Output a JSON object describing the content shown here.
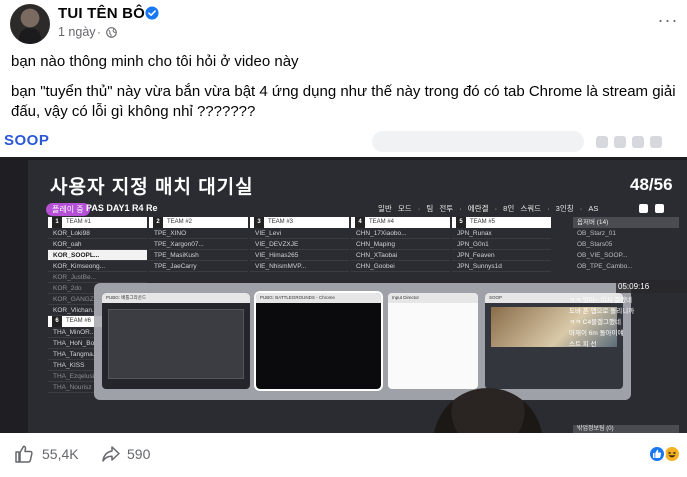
{
  "post": {
    "author": "TUI TÊN BÔ",
    "time": "1 ngày",
    "separator": "·",
    "paragraphs": [
      "bạn nào thông minh cho tôi hỏi ở video này",
      "bạn \"tuyển thủ\" này vừa bắn vừa bật 4 ứng dụng như thế này trong đó có tab Chrome là stream giải đấu, vậy có lỗi gì không nhỉ ???????"
    ],
    "more_label": "···"
  },
  "video": {
    "platform_logo": "SOOP",
    "lobby_title": "사용자 지정 매치 대기실",
    "player_count": "48/56",
    "tag": "플레이 중",
    "match_name": "PAS DAY1 R4 Re",
    "match_options": "일반 모드 · 팀 전투 · 에란겔 · 8인 스쿼드 · 3인칭 · AS",
    "teams": [
      {
        "num": "1",
        "name": "TEAM #1",
        "slots": [
          "KOR_Loki98",
          "KOR_oah",
          "KOR_SOOPL...",
          "KOR_Kimseong..."
        ],
        "highlight": 2
      },
      {
        "num": "2",
        "name": "TEAM #2",
        "slots": [
          "TPE_XINO",
          "TPE_Xargon07...",
          "TPE_MasiKush",
          "TPE_JaeCarry"
        ],
        "highlight": -1
      },
      {
        "num": "3",
        "name": "TEAM #3",
        "slots": [
          "VIE_Levi",
          "VIE_DEVZXJE",
          "VIE_Himas265",
          "VIE_NhismMVP..."
        ],
        "highlight": -1
      },
      {
        "num": "4",
        "name": "TEAM #4",
        "slots": [
          "CHN_17Xiaobo...",
          "CHN_Maping",
          "CHN_XTaobai",
          "CHN_Goobei"
        ],
        "highlight": -1
      },
      {
        "num": "5",
        "name": "TEAM #5",
        "slots": [
          "JPN_Runax",
          "JPN_G0n1",
          "JPN_Feaven",
          "JPN_Sunnys1d"
        ],
        "highlight": -1
      }
    ],
    "team_lower_rows": [
      [
        "KOR_Kimseong...",
        "KOR_JustBe...",
        "KOR_2do",
        "KOR_GANGZ...",
        "KOR_Vlichan..."
      ],
      [
        "THA_MinOR...",
        "THA_HoN_Bo...",
        "THA_Tangma...",
        "THA_KISS",
        "THA_Ezqelusi...",
        "THA_Nourisz"
      ]
    ],
    "team_six_label": "TEAM #6",
    "team_six_num": "6",
    "spectators_head": "옵저버 (14)",
    "spectators": [
      "OB_Starz_01",
      "OB_Stars05",
      "OB_VIE_SOOP...",
      "OB_TPE_Cambo..."
    ],
    "spectators_foot": "밖업정보팀 (0)",
    "clock": "05:09:16",
    "chat": [
      "ㅋㅋ 앗아~ 피시 걸겠네",
      "도바 폰 앱으로 돌리니까",
      "ㅋㅋ C4블겔그했네",
      "마재이  6m 돌아이얘",
      "스트 피 선"
    ],
    "switcher_windows": [
      {
        "title": "PUBG: 배틀그라운드"
      },
      {
        "title": "PUBG: BATTLEGROUNDS - Chrome"
      },
      {
        "title": "Input Director"
      },
      {
        "title": "SOOP"
      }
    ]
  },
  "footer": {
    "likes": "55,4K",
    "shares": "590"
  },
  "colors": {
    "brand_blue": "#1877f2",
    "soop_blue": "#2b57d6",
    "tag_purple": "#b44fd6"
  }
}
